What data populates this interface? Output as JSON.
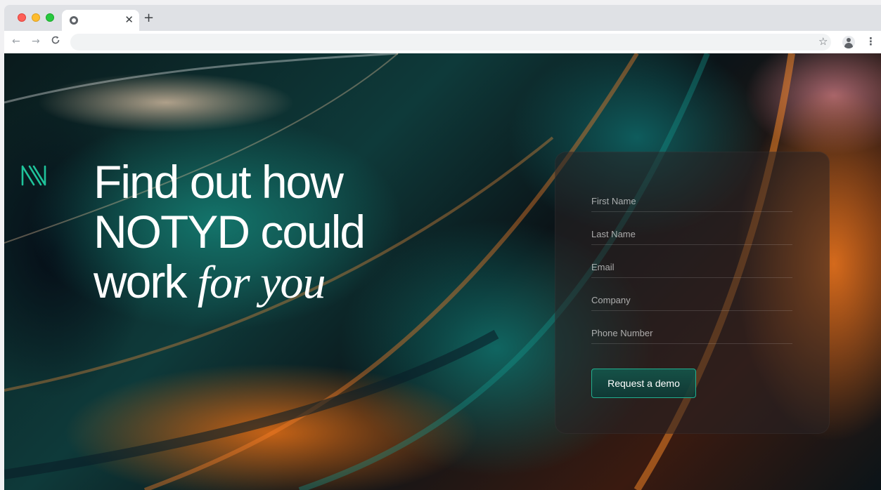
{
  "browser": {
    "tab_close": "✕",
    "new_tab": "+",
    "back": "←",
    "forward": "→",
    "reload": "C",
    "star": "☆",
    "menu": "⋮",
    "url": ""
  },
  "page": {
    "headline": {
      "line1": "Find out how",
      "line2": "NOTYD could",
      "line3_regular": "work ",
      "line3_italic": "for you"
    },
    "form": {
      "first_name": "First Name",
      "last_name": "Last Name",
      "email": "Email",
      "company": "Company",
      "phone": "Phone Number",
      "submit_label": "Request a demo"
    }
  },
  "colors": {
    "accent": "#1fc39a",
    "button_border": "#22b08f"
  },
  "icons": [
    "chrome-favicon-icon",
    "close-icon",
    "plus-icon",
    "back-arrow-icon",
    "forward-arrow-icon",
    "reload-icon",
    "star-icon",
    "profile-icon",
    "more-vert-icon",
    "notyd-logo-icon"
  ]
}
